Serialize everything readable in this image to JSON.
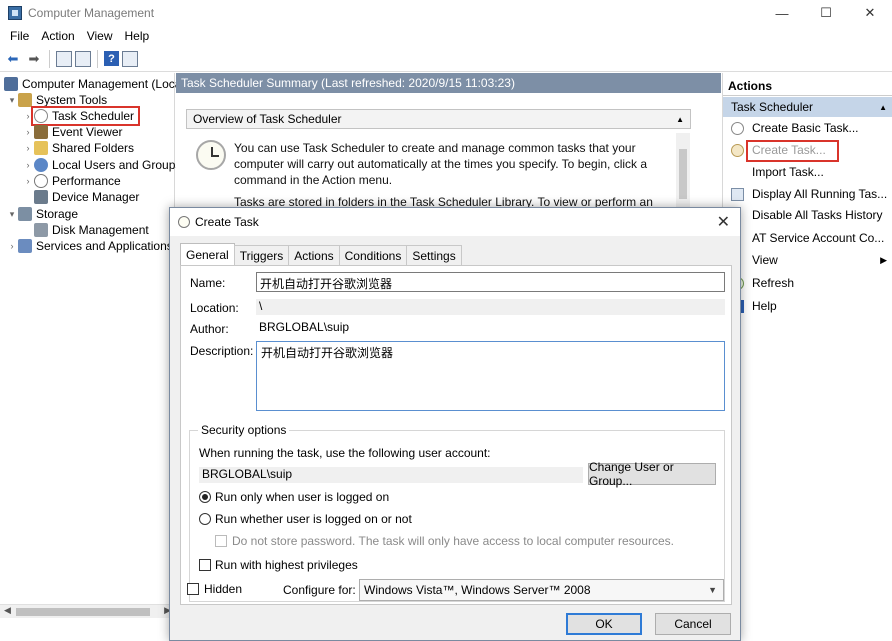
{
  "window": {
    "title": "Computer Management",
    "controls": {
      "minimize": "—",
      "maximize": "☐",
      "close": "✕"
    }
  },
  "menu": [
    "File",
    "Action",
    "View",
    "Help"
  ],
  "tree": {
    "root": "Computer Management (Local",
    "system_tools": "System Tools",
    "task_scheduler": "Task Scheduler",
    "event_viewer": "Event Viewer",
    "shared_folders": "Shared Folders",
    "local_users": "Local Users and Groups",
    "performance": "Performance",
    "device_manager": "Device Manager",
    "storage": "Storage",
    "disk_management": "Disk Management",
    "services": "Services and Applications"
  },
  "center": {
    "summary_title": "Task Scheduler Summary (Last refreshed: 2020/9/15 11:03:23)",
    "overview_title": "Overview of Task Scheduler",
    "overview_p1": "You can use Task Scheduler to create and manage common tasks that your computer will carry out automatically at the times you specify. To begin, click a command in the Action menu.",
    "overview_p2": "Tasks are stored in folders in the Task Scheduler Library. To view or perform an operation"
  },
  "actions": {
    "header": "Actions",
    "section": "Task Scheduler",
    "items": [
      "Create Basic Task...",
      "Create Task...",
      "Import Task...",
      "Display All Running Tas...",
      "Disable All Tasks History",
      "AT Service Account Co...",
      "View",
      "Refresh",
      "Help"
    ]
  },
  "dialog": {
    "title": "Create Task",
    "close": "✕",
    "tabs": [
      "General",
      "Triggers",
      "Actions",
      "Conditions",
      "Settings"
    ],
    "name_label": "Name:",
    "name_value": "开机自动打开谷歌浏览器",
    "location_label": "Location:",
    "location_value": "\\",
    "author_label": "Author:",
    "author_value": "BRGLOBAL\\suip",
    "description_label": "Description:",
    "description_value": "开机自动打开谷歌浏览器",
    "security_title": "Security options",
    "security_prompt": "When running the task, use the following user account:",
    "account_value": "BRGLOBAL\\suip",
    "change_user_button": "Change User or Group...",
    "radio_logged_on": "Run only when user is logged on",
    "radio_whether": "Run whether user is logged on or not",
    "no_store_password": "Do not store password.  The task will only have access to local computer resources.",
    "highest_privileges": "Run with highest privileges",
    "hidden_label": "Hidden",
    "configure_label": "Configure for:",
    "configure_value": "Windows Vista™, Windows Server™ 2008",
    "ok_button": "OK",
    "cancel_button": "Cancel"
  }
}
